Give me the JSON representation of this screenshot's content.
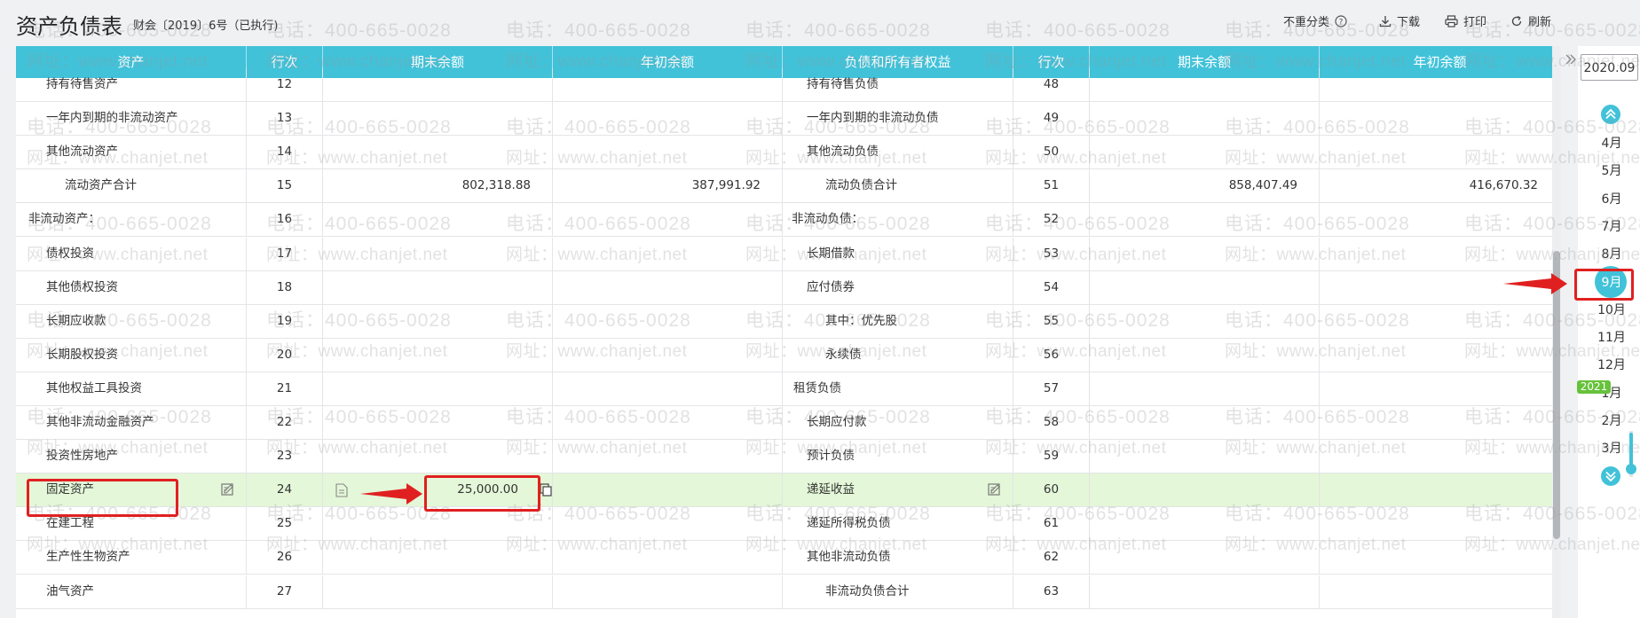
{
  "header": {
    "title": "资产负债表",
    "subtitle": "财会〔2019〕6号（已执行)",
    "tools": [
      {
        "label": "不重分类",
        "icon": "help-circle-icon"
      },
      {
        "label": "下载",
        "icon": "download-icon"
      },
      {
        "label": "打印",
        "icon": "print-icon"
      },
      {
        "label": "刷新",
        "icon": "refresh-icon"
      }
    ]
  },
  "columns": {
    "asset": "资产",
    "asset_line": "行次",
    "asset_end": "期末余额",
    "asset_begin": "年初余额",
    "liab": "负债和所有者权益",
    "liab_line": "行次",
    "liab_end": "期末余额",
    "liab_begin": "年初余额"
  },
  "rows": [
    {
      "left": {
        "name": "持有待售资产",
        "line": "12",
        "end": "",
        "begin": ""
      },
      "right": {
        "name": "持有待售负债",
        "line": "48",
        "end": "",
        "begin": ""
      }
    },
    {
      "left": {
        "name": "一年内到期的非流动资产",
        "line": "13",
        "end": "",
        "begin": ""
      },
      "right": {
        "name": "一年内到期的非流动负债",
        "line": "49",
        "end": "",
        "begin": ""
      }
    },
    {
      "left": {
        "name": "其他流动资产",
        "line": "14",
        "end": "",
        "begin": ""
      },
      "right": {
        "name": "其他流动负债",
        "line": "50",
        "end": "",
        "begin": ""
      }
    },
    {
      "left": {
        "name": "流动资产合计",
        "line": "15",
        "end": "802,318.88",
        "begin": "387,991.92"
      },
      "right": {
        "name": "流动负债合计",
        "line": "51",
        "end": "858,407.49",
        "begin": "416,670.32"
      }
    },
    {
      "left": {
        "name": "非流动资产：",
        "line": "16",
        "end": "",
        "begin": ""
      },
      "right": {
        "name": "非流动负债：",
        "line": "52",
        "end": "",
        "begin": ""
      }
    },
    {
      "left": {
        "name": "债权投资",
        "line": "17",
        "end": "",
        "begin": ""
      },
      "right": {
        "name": "长期借款",
        "line": "53",
        "end": "",
        "begin": ""
      }
    },
    {
      "left": {
        "name": "其他债权投资",
        "line": "18",
        "end": "",
        "begin": ""
      },
      "right": {
        "name": "应付债券",
        "line": "54",
        "end": "",
        "begin": ""
      }
    },
    {
      "left": {
        "name": "长期应收款",
        "line": "19",
        "end": "",
        "begin": ""
      },
      "right": {
        "name": "其中：优先股",
        "line": "55",
        "end": "",
        "begin": ""
      }
    },
    {
      "left": {
        "name": "长期股权投资",
        "line": "20",
        "end": "",
        "begin": ""
      },
      "right": {
        "name": "永续债",
        "line": "56",
        "end": "",
        "begin": ""
      }
    },
    {
      "left": {
        "name": "其他权益工具投资",
        "line": "21",
        "end": "",
        "begin": ""
      },
      "right": {
        "name": "租赁负债",
        "line": "57",
        "end": "",
        "begin": ""
      }
    },
    {
      "left": {
        "name": "其他非流动金融资产",
        "line": "22",
        "end": "",
        "begin": ""
      },
      "right": {
        "name": "长期应付款",
        "line": "58",
        "end": "",
        "begin": ""
      }
    },
    {
      "left": {
        "name": "投资性房地产",
        "line": "23",
        "end": "",
        "begin": ""
      },
      "right": {
        "name": "预计负债",
        "line": "59",
        "end": "",
        "begin": ""
      }
    },
    {
      "left": {
        "name": "固定资产",
        "line": "24",
        "end": "25,000.00",
        "begin": ""
      },
      "right": {
        "name": "递延收益",
        "line": "60",
        "end": "",
        "begin": ""
      }
    },
    {
      "left": {
        "name": "在建工程",
        "line": "25",
        "end": "",
        "begin": ""
      },
      "right": {
        "name": "递延所得税负债",
        "line": "61",
        "end": "",
        "begin": ""
      }
    },
    {
      "left": {
        "name": "生产性生物资产",
        "line": "26",
        "end": "",
        "begin": ""
      },
      "right": {
        "name": "其他非流动负债",
        "line": "62",
        "end": "",
        "begin": ""
      }
    },
    {
      "left": {
        "name": "油气资产",
        "line": "27",
        "end": "",
        "begin": ""
      },
      "right": {
        "name": "非流动负债合计",
        "line": "63",
        "end": "",
        "begin": ""
      }
    }
  ],
  "period": {
    "current": "2020.09",
    "months": [
      "4月",
      "5月",
      "6月",
      "7月",
      "8月",
      "9月",
      "10月",
      "11月",
      "12月",
      "1月",
      "2月",
      "3月"
    ],
    "selected": "9月",
    "year_badge": "2021"
  },
  "watermark": {
    "phone": "电话：400-665-0028",
    "url": "网址：www.chanjet.net"
  },
  "colors": {
    "header_bg": "#41c2d9",
    "highlight_row": "#e4f7d8",
    "annotation": "#e02020",
    "year_badge": "#66c23a"
  }
}
